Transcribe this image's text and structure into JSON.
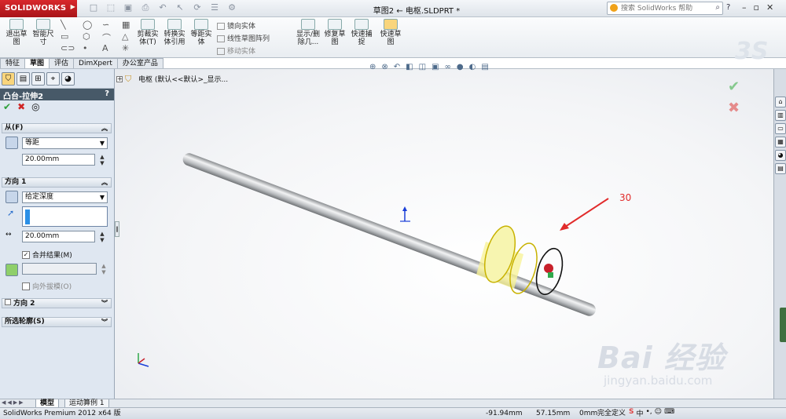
{
  "app": {
    "logo": "SOLIDWORKS",
    "doc_title": "草图2 ← 电枢.SLDPRT *"
  },
  "help": {
    "placeholder": "搜索 SolidWorks 帮助"
  },
  "ribbon": {
    "exit_sketch": "退出草图",
    "smart_dim": "智能尺寸",
    "trim": "剪裁实体(T)",
    "convert": "转换实体引用",
    "offset": "等距实体",
    "mirror": "镜向实体",
    "linear_pattern": "线性草图阵列",
    "move": "移动实体",
    "display_delete": "显示/删除几...",
    "repair": "修复草图",
    "quick_snaps": "快速捕捉",
    "rapid_sketch": "快速草图"
  },
  "tabs": [
    "特征",
    "草图",
    "评估",
    "DimXpert",
    "办公室产品"
  ],
  "feature_tree": {
    "root": "电枢 (默认<<默认>_显示..."
  },
  "property_manager": {
    "title": "凸台-拉伸2",
    "help": "?",
    "from_header": "从(F)",
    "from_type": "等距",
    "from_offset": "20.00mm",
    "dir1_header": "方向 1",
    "dir1_type": "给定深度",
    "dir1_depth": "20.00mm",
    "merge_result": "合并结果(M)",
    "draft_outward": "向外拔模(O)",
    "dir2_header": "方向 2",
    "contours_header": "所选轮廓(S)"
  },
  "annotation": "30",
  "bottom_tabs": [
    "模型",
    "运动算例 1"
  ],
  "status": {
    "product": "SolidWorks Premium 2012 x64 版",
    "x": "-91.94mm",
    "y": "57.15mm",
    "z": "0mm",
    "state": "完全定义"
  },
  "ime": {
    "s": "S",
    "cn": "中"
  },
  "watermark": {
    "brand": "Bai 经验",
    "url": "jingyan.baidu.com"
  },
  "colors": {
    "accent": "#c8202a",
    "ok": "#2ea03a",
    "cancel": "#d02525",
    "cylinder": "#f2ee4a",
    "arrow": "#e12b2b"
  }
}
